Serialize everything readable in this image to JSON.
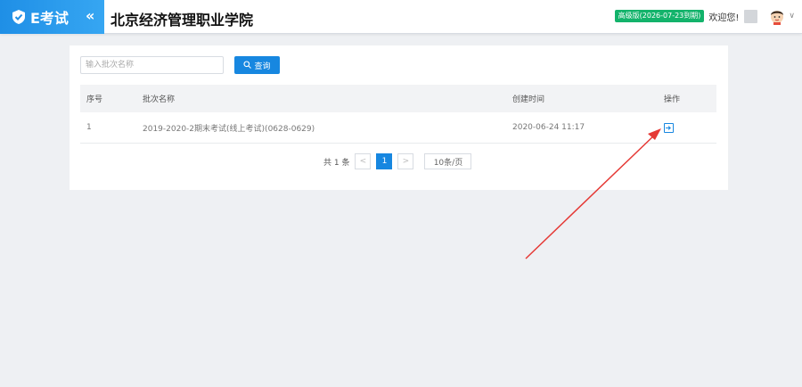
{
  "header": {
    "brand": "E考试",
    "collapse_glyph": "«",
    "school": "北京经济管理职业学院",
    "badge": "高级版(2026-07-23到期)",
    "welcome": "欢迎您!",
    "dropdown_glyph": "∨"
  },
  "search": {
    "placeholder": "输入批次名称",
    "button_label": "查询"
  },
  "table": {
    "columns": [
      "序号",
      "批次名称",
      "创建时间",
      "操作"
    ],
    "rows": [
      {
        "index": "1",
        "name": "2019-2020-2期末考试(线上考试)(0628-0629)",
        "created": "2020-06-24 11:17"
      }
    ]
  },
  "pagination": {
    "total": "共 1 条",
    "prev": "<",
    "current": "1",
    "next": ">",
    "page_size": "10条/页"
  },
  "colors": {
    "accent": "#1787e0",
    "badge": "#13b36b",
    "annotation": "#e53935"
  }
}
